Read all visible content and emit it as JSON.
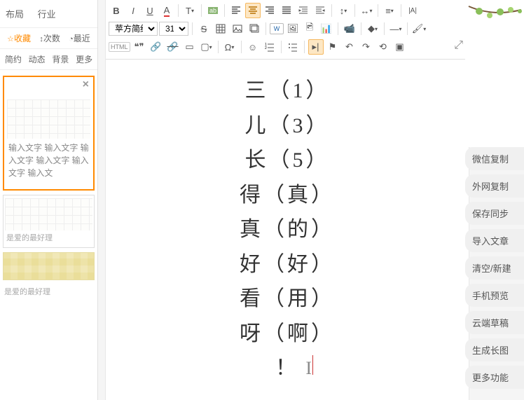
{
  "left": {
    "top": {
      "layout": "布局",
      "industry": "行业"
    },
    "row2": {
      "fav": "收藏",
      "count": "次数",
      "recent": "最近"
    },
    "row3": {
      "simple": "简约",
      "dynamic": "动态",
      "bg": "背景",
      "more": "更多"
    },
    "placeholder": "输入文字 输入文字 输入文字 输入文字 输入文字 输入文",
    "lbl1": "是爱的最好理",
    "lbl2": "是爱的最好理"
  },
  "toolbar": {
    "font": "苹方简细",
    "size": "31px",
    "html": "HTML"
  },
  "doc": {
    "l1": "三（1）",
    "l2": "儿（3）",
    "l3": "长（5）",
    "l4": "得（真）",
    "l5": "真（的）",
    "l6": "好（好）",
    "l7": "看（用）",
    "l8": "呀（啊）",
    "l9": "！"
  },
  "right": {
    "m1": "微信复制",
    "m2": "外网复制",
    "m3": "保存同步",
    "m4": "导入文章",
    "m5": "清空/新建",
    "m6": "手机预览",
    "m7": "云端草稿",
    "m8": "生成长图",
    "m9": "更多功能"
  }
}
